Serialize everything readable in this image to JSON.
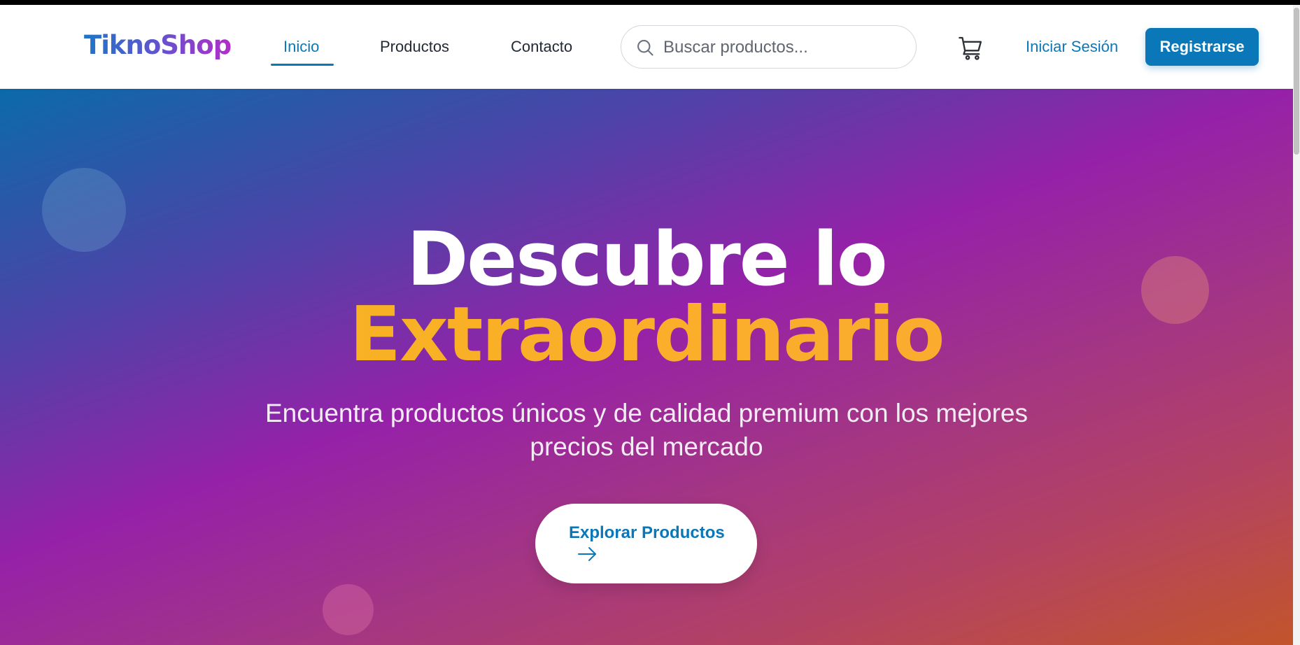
{
  "header": {
    "logo": "TiknoShop",
    "nav": [
      {
        "label": "Inicio",
        "active": true
      },
      {
        "label": "Productos",
        "active": false
      },
      {
        "label": "Contacto",
        "active": false
      }
    ],
    "search": {
      "placeholder": "Buscar productos...",
      "value": "",
      "icon": "search-icon"
    },
    "cart_icon": "shopping-cart-icon",
    "login_label": "Iniciar Sesión",
    "register_label": "Registrarse"
  },
  "hero": {
    "title_line1": "Descubre lo",
    "title_line2": "Extraordinario",
    "subtitle": "Encuentra productos únicos y de calidad premium con los mejores precios del mercado",
    "cta_label": "Explorar Productos",
    "cta_icon": "arrow-right-icon"
  },
  "colors": {
    "primary": "#0a78b8",
    "accent": "#f7b51f",
    "gradient": [
      "#0b6aa9",
      "#9621a8",
      "#c2552b"
    ]
  }
}
